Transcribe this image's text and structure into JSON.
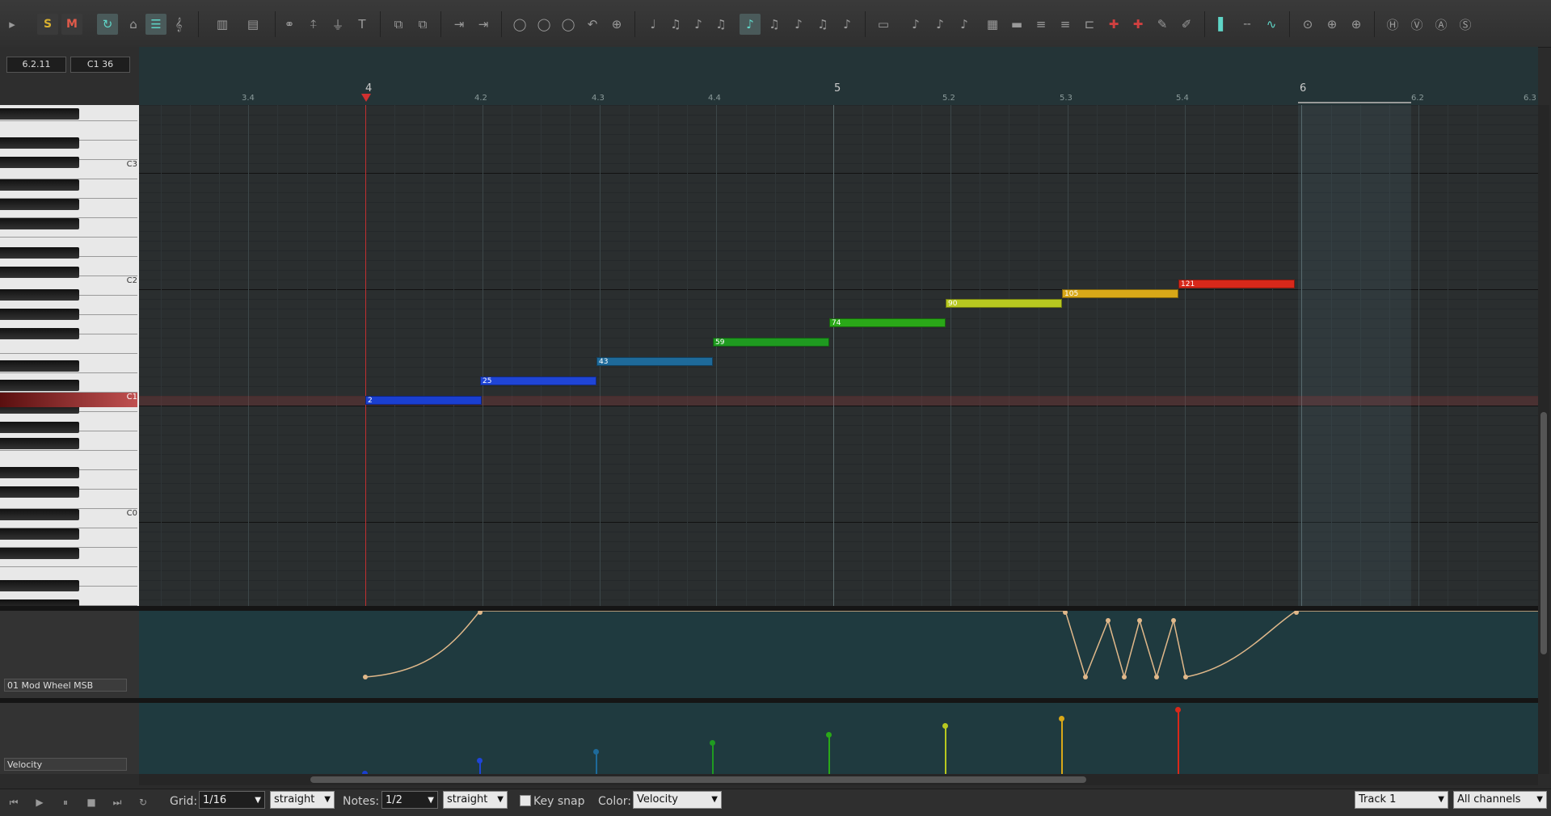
{
  "toolbar": {
    "solo_label": "S",
    "mute_label": "M"
  },
  "position": {
    "time": "6.2.11",
    "pitch": "C1  36"
  },
  "ruler": {
    "bars": [
      "4",
      "5",
      "6"
    ],
    "beats": [
      "3.4",
      "4.2",
      "4.3",
      "4.4",
      "5.2",
      "5.3",
      "5.4",
      "6.2",
      "6.3"
    ]
  },
  "keyboard": {
    "labels": [
      "C3",
      "C2",
      "C1",
      "C0"
    ]
  },
  "notes": [
    {
      "velocity": "2",
      "color": "#1a3fd0"
    },
    {
      "velocity": "25",
      "color": "#1f45d6"
    },
    {
      "velocity": "43",
      "color": "#1e6a9a"
    },
    {
      "velocity": "59",
      "color": "#1f9a20"
    },
    {
      "velocity": "74",
      "color": "#2aa818"
    },
    {
      "velocity": "90",
      "color": "#b7c820"
    },
    {
      "velocity": "105",
      "color": "#d8a818"
    },
    {
      "velocity": "121",
      "color": "#d8281a"
    }
  ],
  "lanes": {
    "cc_label": "01 Mod Wheel MSB",
    "velocity_label": "Velocity"
  },
  "bottom": {
    "grid_label": "Grid:",
    "grid_value": "1/16",
    "grid_type": "straight",
    "notes_label": "Notes:",
    "notes_value": "1/2",
    "notes_type": "straight",
    "keysnap_label": "Key snap",
    "color_label": "Color:",
    "color_value": "Velocity",
    "track_value": "Track 1",
    "channel_value": "All channels"
  }
}
